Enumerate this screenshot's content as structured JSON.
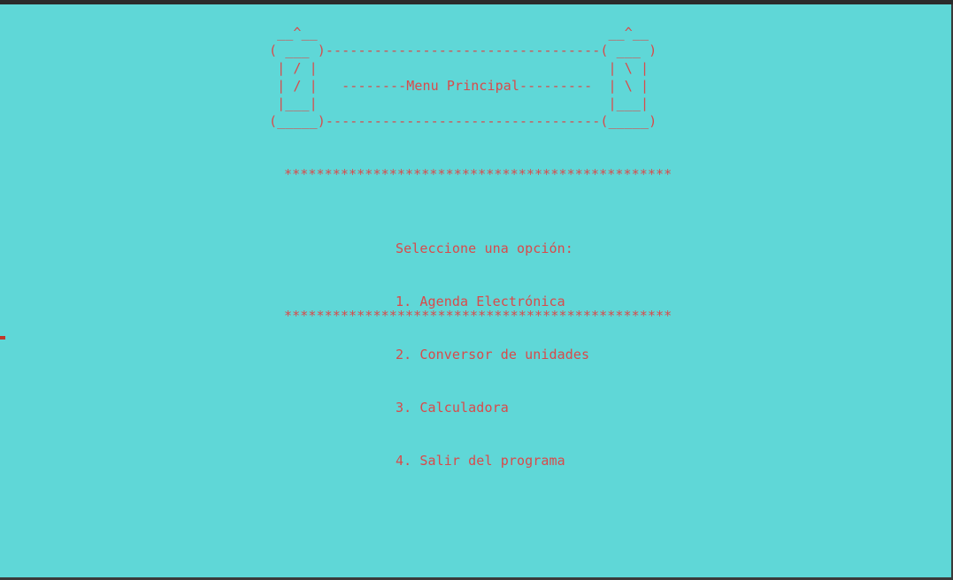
{
  "console": {
    "background": "#5fd7d7",
    "text_color": "#d94a4a",
    "banner_lines": [
      " __^__                                    __^__",
      "( ___ )----------------------------------( ___ )",
      " | / |                                    | \\ |",
      " | / |   --------Menu Principal---------  | \\ |",
      " |___|                                    |___|",
      "(_____)----------------------------------(_____)"
    ],
    "separator_top": "************************************************",
    "menu": {
      "prompt": "Seleccione una opción:",
      "options": [
        "1. Agenda Electrónica",
        "2. Conversor de unidades",
        "3. Calculadora",
        "4. Salir del programa"
      ]
    },
    "separator_bottom": "************************************************"
  }
}
